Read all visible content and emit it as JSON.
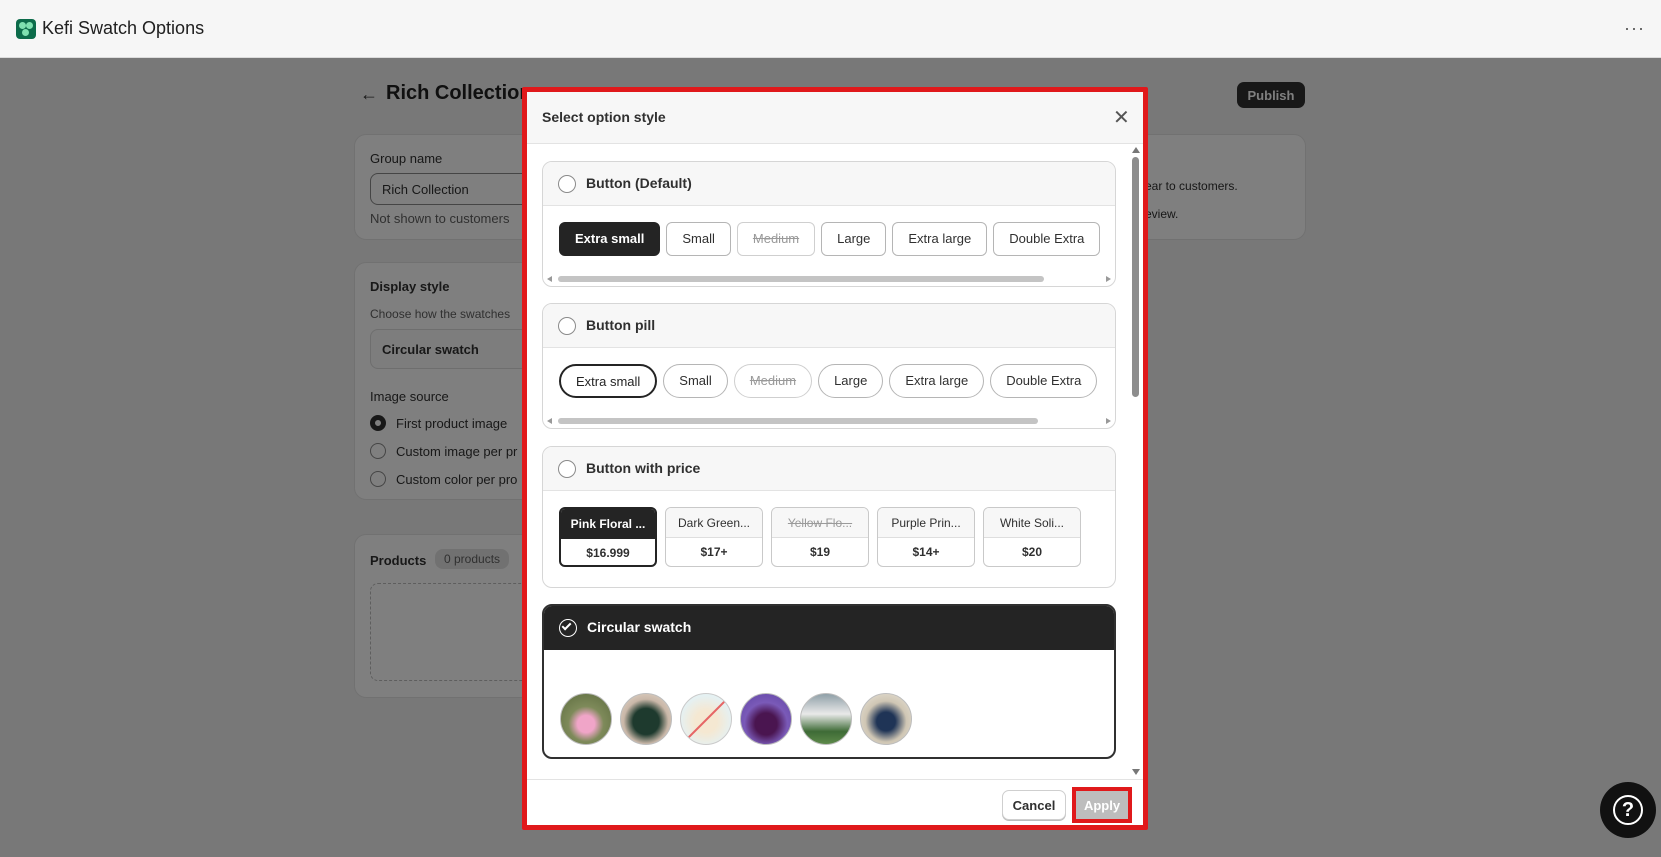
{
  "app": {
    "title": "Kefi Swatch Options",
    "more": "···"
  },
  "page": {
    "back": "←",
    "title": "Rich Collection",
    "publish": "Publish",
    "group": {
      "label": "Group name",
      "value": "Rich Collection",
      "hint": "Not shown to customers"
    },
    "side": {
      "line1": "ear to customers.",
      "line2": "eview."
    },
    "display": {
      "title": "Display style",
      "desc": "Choose how the swatches",
      "select": "Circular swatch",
      "image_source": "Image source",
      "options": [
        "First product image",
        "Custom image per pr",
        "Custom color per pro"
      ]
    },
    "products": {
      "title": "Products",
      "count": "0 products"
    }
  },
  "modal": {
    "title": "Select option style",
    "close": "✕",
    "cancel": "Cancel",
    "apply": "Apply",
    "styles": {
      "button": {
        "title": "Button (Default)",
        "chips": [
          "Extra small",
          "Small",
          "Medium",
          "Large",
          "Extra large",
          "Double Extra"
        ]
      },
      "pill": {
        "title": "Button pill",
        "chips": [
          "Extra small",
          "Small",
          "Medium",
          "Large",
          "Extra large",
          "Double Extra"
        ]
      },
      "price": {
        "title": "Button with price",
        "items": [
          {
            "name": "Pink Floral ...",
            "price": "$16.999"
          },
          {
            "name": "Dark Green...",
            "price": "$17+"
          },
          {
            "name": "Yellow Flo...",
            "price": "$19"
          },
          {
            "name": "Purple Prin...",
            "price": "$14+"
          },
          {
            "name": "White Soli...",
            "price": "$20"
          }
        ]
      },
      "circular": {
        "title": "Circular swatch"
      }
    }
  },
  "colors": {
    "accent_red": "#e0191b",
    "dark": "#242424",
    "apply_disabled": "#bdbdbd"
  }
}
